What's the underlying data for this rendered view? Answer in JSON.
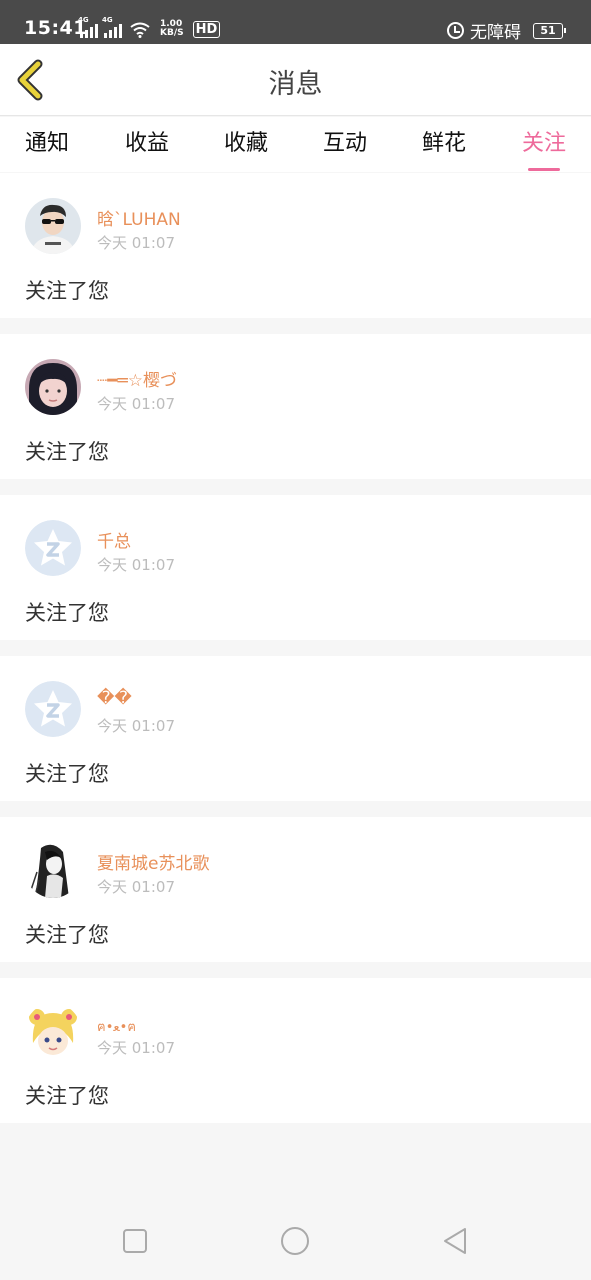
{
  "status_bar": {
    "time": "15:41",
    "net1": "4G",
    "net2": "4G",
    "speed_value": "1.00",
    "speed_unit": "KB/S",
    "hd": "HD",
    "accessibility": "无障碍",
    "battery": "51"
  },
  "header": {
    "title": "消息",
    "back_icon": "chevron-left-icon"
  },
  "tabs": [
    {
      "label": "通知",
      "active": false
    },
    {
      "label": "收益",
      "active": false
    },
    {
      "label": "收藏",
      "active": false
    },
    {
      "label": "互动",
      "active": false
    },
    {
      "label": "鲜花",
      "active": false
    },
    {
      "label": "关注",
      "active": true
    }
  ],
  "items": [
    {
      "name": "晗`LUHAN",
      "time": "今天 01:07",
      "message": "关注了您",
      "avatar": "photo-avatar"
    },
    {
      "name": "┈━═☆樱づ",
      "time": "今天 01:07",
      "message": "关注了您",
      "avatar": "photo-avatar"
    },
    {
      "name": "千总",
      "time": "今天 01:07",
      "message": "关注了您",
      "avatar": "qq-default-avatar"
    },
    {
      "name": "��",
      "time": "今天 01:07",
      "message": "关注了您",
      "avatar": "qq-default-avatar"
    },
    {
      "name": "夏南城e苏北歌",
      "time": "今天 01:07",
      "message": "关注了您",
      "avatar": "sketch-avatar"
    },
    {
      "name": "ฅ•ﻌ•ฅ",
      "time": "今天 01:07",
      "message": "关注了您",
      "avatar": "cartoon-avatar"
    }
  ],
  "colors": {
    "accent": "#ee6a9b",
    "username": "#e8905a",
    "back_icon": "#e8d23a"
  }
}
